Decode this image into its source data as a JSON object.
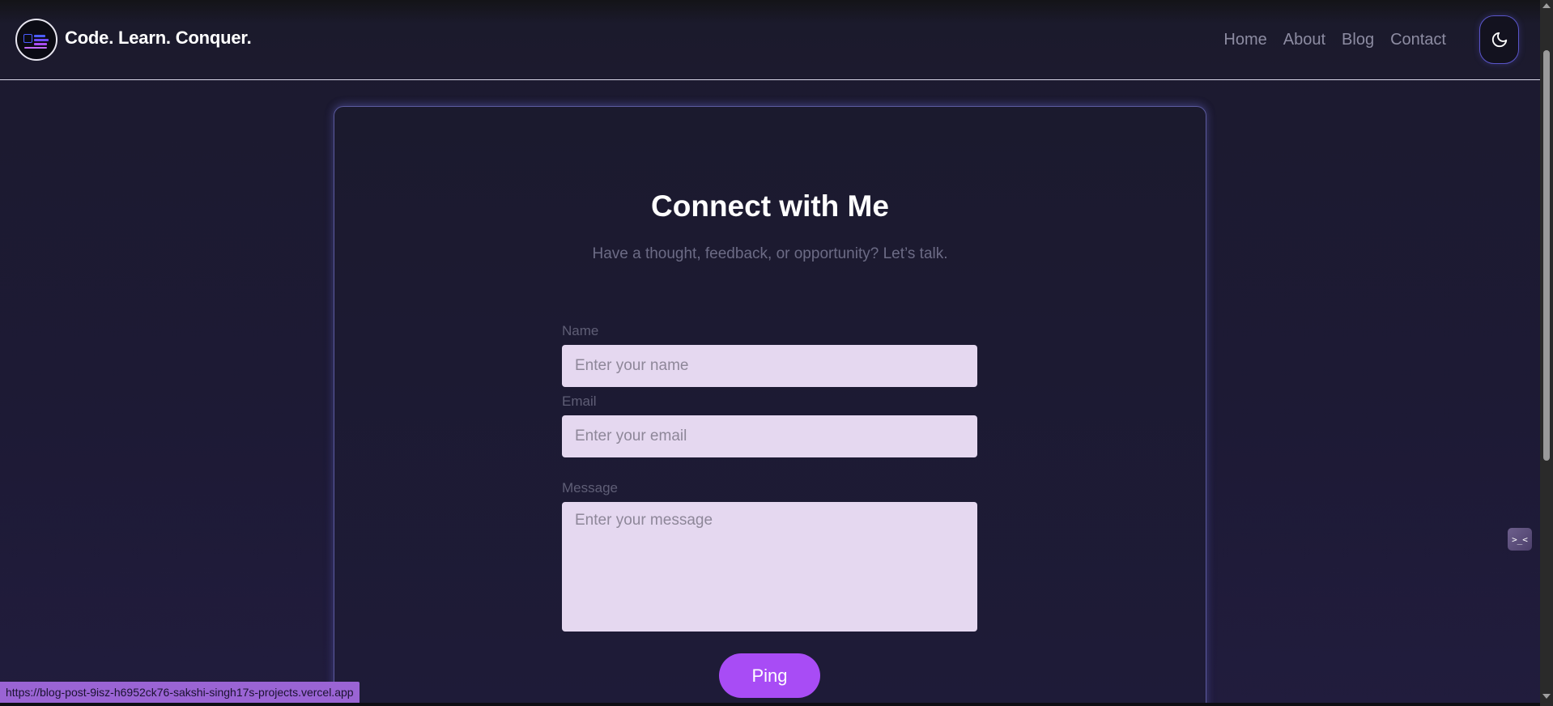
{
  "header": {
    "site_title": "Code. Learn. Conquer.",
    "logo_icon": "code-learn-conquer-logo",
    "nav": [
      {
        "label": "Home"
      },
      {
        "label": "About"
      },
      {
        "label": "Blog"
      },
      {
        "label": "Contact"
      }
    ],
    "theme_toggle_icon": "moon-icon"
  },
  "contact": {
    "title": "Connect with Me",
    "subtitle": "Have a thought, feedback, or opportunity? Let’s talk.",
    "fields": {
      "name": {
        "label": "Name",
        "placeholder": "Enter your name",
        "value": ""
      },
      "email": {
        "label": "Email",
        "placeholder": "Enter your email",
        "value": ""
      },
      "message": {
        "label": "Message",
        "placeholder": "Enter your message",
        "value": ""
      }
    },
    "submit_label": "Ping"
  },
  "widget": {
    "label": ">_<"
  },
  "status_bar": {
    "url": "https://blog-post-9isz-h6952ck76-sakshi-singh17s-projects.vercel.app"
  },
  "colors": {
    "background": "#1c1a2e",
    "accent": "#a84cf5",
    "field_background": "#e5d8f0",
    "card_border": "#5b5a9e"
  }
}
